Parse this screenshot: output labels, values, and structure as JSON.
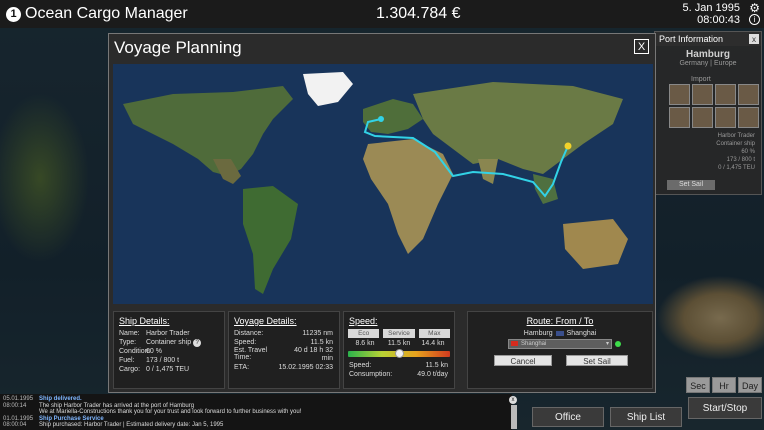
{
  "app": {
    "badge": "1",
    "title": "Ocean Cargo Manager"
  },
  "header": {
    "money": "1.304.784 €",
    "date": "5. Jan 1995",
    "time": "08:00:43"
  },
  "port_panel": {
    "title": "Port Information",
    "name": "Hamburg",
    "region": "Germany | Europe",
    "goods_label": "Import",
    "ship_label": "Harbor Trader",
    "stats": [
      "Container ship",
      "60 %",
      "173 / 800 t",
      "0 / 1,475 TEU"
    ],
    "button": "Set Sail"
  },
  "modal": {
    "title": "Voyage Planning",
    "close": "X",
    "map": {
      "origin": "Hamburg",
      "destination": "Shanghai"
    },
    "ship_details": {
      "heading": "Ship Details:",
      "rows": [
        {
          "k": "Name:",
          "v": "Harbor Trader"
        },
        {
          "k": "Type:",
          "v": "Container ship"
        },
        {
          "k": "Condition:",
          "v": "60 %"
        },
        {
          "k": "Fuel:",
          "v": "173 / 800 t"
        },
        {
          "k": "Cargo:",
          "v": "0 / 1,475 TEU"
        }
      ],
      "type_badge": "?"
    },
    "voyage_details": {
      "heading": "Voyage Details:",
      "rows": [
        {
          "k": "Distance:",
          "v": "11235 nm"
        },
        {
          "k": "Speed:",
          "v": "11.5 kn"
        },
        {
          "k": "Est. Travel Time:",
          "v": "40 d 18 h 32 min"
        },
        {
          "k": "ETA:",
          "v": "15.02.1995 02:33"
        }
      ]
    },
    "speed": {
      "heading": "Speed:",
      "buttons": [
        "Eco",
        "Service",
        "Max"
      ],
      "values": [
        "8.6 kn",
        "11.5 kn",
        "14.4 kn"
      ],
      "level": 0.5,
      "speed_label": "Speed:",
      "speed_value": "11.5 kn",
      "consumption_label": "Consumption:",
      "consumption_value": "49.0 t/day"
    },
    "route": {
      "heading": "Route: From / To",
      "from": "Hamburg",
      "to": "Shanghai",
      "select_value": "Shanghai",
      "cancel": "Cancel",
      "set_sail": "Set Sail"
    }
  },
  "log": [
    {
      "time": "05.01.1995",
      "head": "Ship delivered."
    },
    {
      "time": "08:00:14",
      "text": "The ship Harbor Trader has arrived at the port of Hamburg"
    },
    {
      "time": "",
      "text": "We at Mariella-Constructions thank you for your trust and look forward to further business with you!"
    },
    {
      "time": "01.01.1995",
      "head": "Ship Purchase Service"
    },
    {
      "time": "08:00:04",
      "text": "Ship purchased: Harbor Trader | Estimated delivery date: Jan 5, 1995"
    }
  ],
  "bottom": {
    "office": "Office",
    "ship_list": "Ship List",
    "start_stop": "Start/Stop"
  },
  "time_controls": [
    "Sec",
    "Hr",
    "Day"
  ]
}
